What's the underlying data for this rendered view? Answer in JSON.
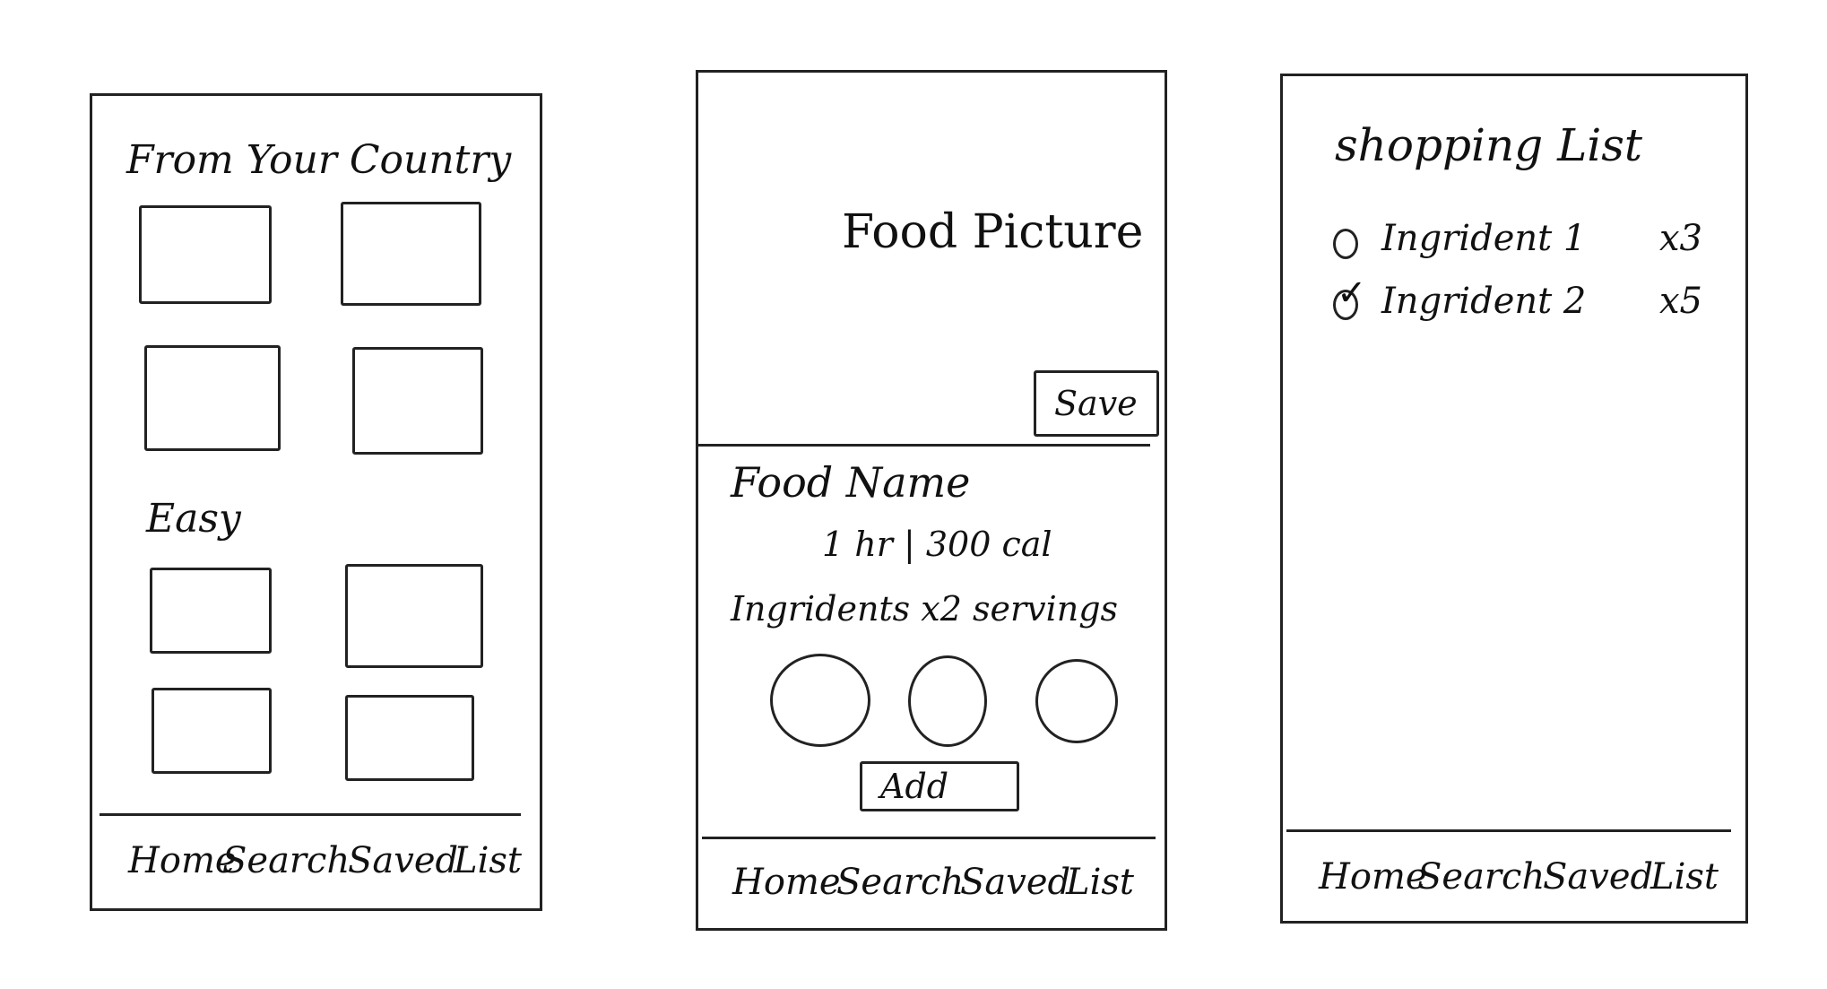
{
  "home": {
    "section1_title": "From Your Country",
    "section2_title": "Easy",
    "nav": [
      "Home",
      "Search",
      "Saved",
      "List"
    ]
  },
  "detail": {
    "picture_label": "Food Picture",
    "save_label": "Save",
    "food_name": "Food Name",
    "meta": "1 hr | 300 cal",
    "ingredients_header": "Ingridents x2 servings",
    "add_label": "Add",
    "nav": [
      "Home",
      "Search",
      "Saved",
      "List"
    ]
  },
  "list": {
    "title": "shopping List",
    "items": [
      {
        "name": "Ingrident 1",
        "qty": "x3",
        "checked": false
      },
      {
        "name": "Ingrident 2",
        "qty": "x5",
        "checked": true
      }
    ],
    "nav": [
      "Home",
      "Search",
      "Saved",
      "List"
    ]
  }
}
